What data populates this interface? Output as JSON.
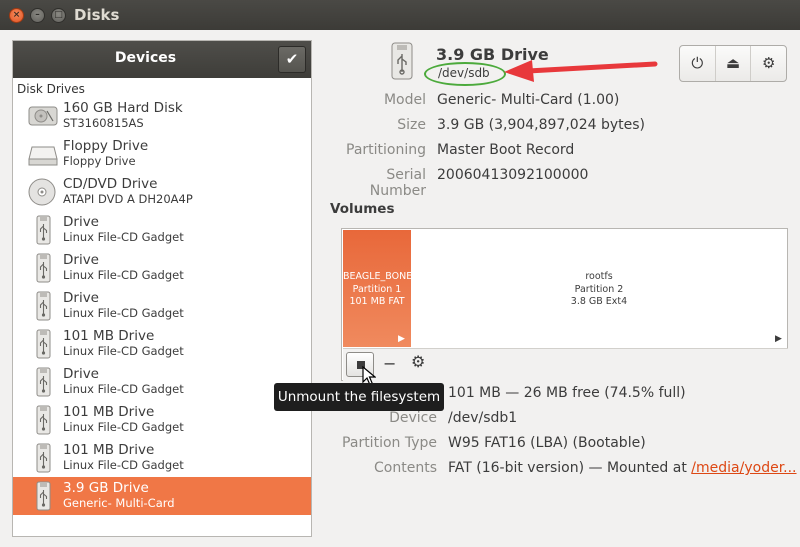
{
  "window": {
    "title": "Disks",
    "controls": {
      "close": "×",
      "minimize": "–",
      "maximize": "□"
    }
  },
  "sidebar": {
    "header": "Devices",
    "check_glyph": "✔",
    "group_label": "Disk Drives",
    "items": [
      {
        "name": "160 GB Hard Disk",
        "sub": "ST3160815AS",
        "icon": "hard-disk-icon"
      },
      {
        "name": "Floppy Drive",
        "sub": "Floppy Drive",
        "icon": "floppy-drive-icon"
      },
      {
        "name": "CD/DVD Drive",
        "sub": "ATAPI   DVD A  DH20A4P",
        "icon": "optical-drive-icon"
      },
      {
        "name": "Drive",
        "sub": "Linux File-CD Gadget",
        "icon": "usb-drive-icon"
      },
      {
        "name": "Drive",
        "sub": "Linux File-CD Gadget",
        "icon": "usb-drive-icon"
      },
      {
        "name": "Drive",
        "sub": "Linux File-CD Gadget",
        "icon": "usb-drive-icon"
      },
      {
        "name": "101 MB Drive",
        "sub": "Linux File-CD Gadget",
        "icon": "usb-drive-icon"
      },
      {
        "name": "Drive",
        "sub": "Linux File-CD Gadget",
        "icon": "usb-drive-icon"
      },
      {
        "name": "101 MB Drive",
        "sub": "Linux File-CD Gadget",
        "icon": "usb-drive-icon"
      },
      {
        "name": "101 MB Drive",
        "sub": "Linux File-CD Gadget",
        "icon": "usb-drive-icon"
      },
      {
        "name": "3.9 GB Drive",
        "sub": "Generic- Multi-Card",
        "icon": "usb-drive-icon",
        "selected": true
      }
    ]
  },
  "drive": {
    "title": "3.9 GB Drive",
    "path": "/dev/sdb",
    "toolbar": {
      "power": "⏻",
      "eject": "⏏",
      "settings": "⚙"
    },
    "properties": {
      "model_key": "Model",
      "model": "Generic- Multi-Card (1.00)",
      "size_key": "Size",
      "size": "3.9 GB (3,904,897,024 bytes)",
      "partitioning_key": "Partitioning",
      "partitioning": "Master Boot Record",
      "serial_key": "Serial Number",
      "serial": "20060413092100000"
    }
  },
  "volumes": {
    "label": "Volumes",
    "partitions": [
      {
        "name": "BEAGLE_BONE",
        "number": "Partition 1",
        "size": "101 MB FAT"
      },
      {
        "name": "rootfs",
        "number": "Partition 2",
        "size": "3.8 GB Ext4"
      }
    ],
    "play_glyph": "▶",
    "toolbar": {
      "minus": "−",
      "gear": "⚙"
    },
    "tooltip": "Unmount the filesystem",
    "details": {
      "size": "101 MB — 26 MB free (74.5% full)",
      "device_key": "Device",
      "device": "/dev/sdb1",
      "partition_type_key": "Partition Type",
      "partition_type": "W95 FAT16 (LBA) (Bootable)",
      "contents_key": "Contents",
      "contents_prefix": "FAT (16-bit version) — Mounted at ",
      "contents_link": "/media/yoder..."
    }
  },
  "colors": {
    "accent": "#f07746",
    "annotation_arrow": "#e8383b",
    "annotation_ring": "#4caa3c"
  }
}
